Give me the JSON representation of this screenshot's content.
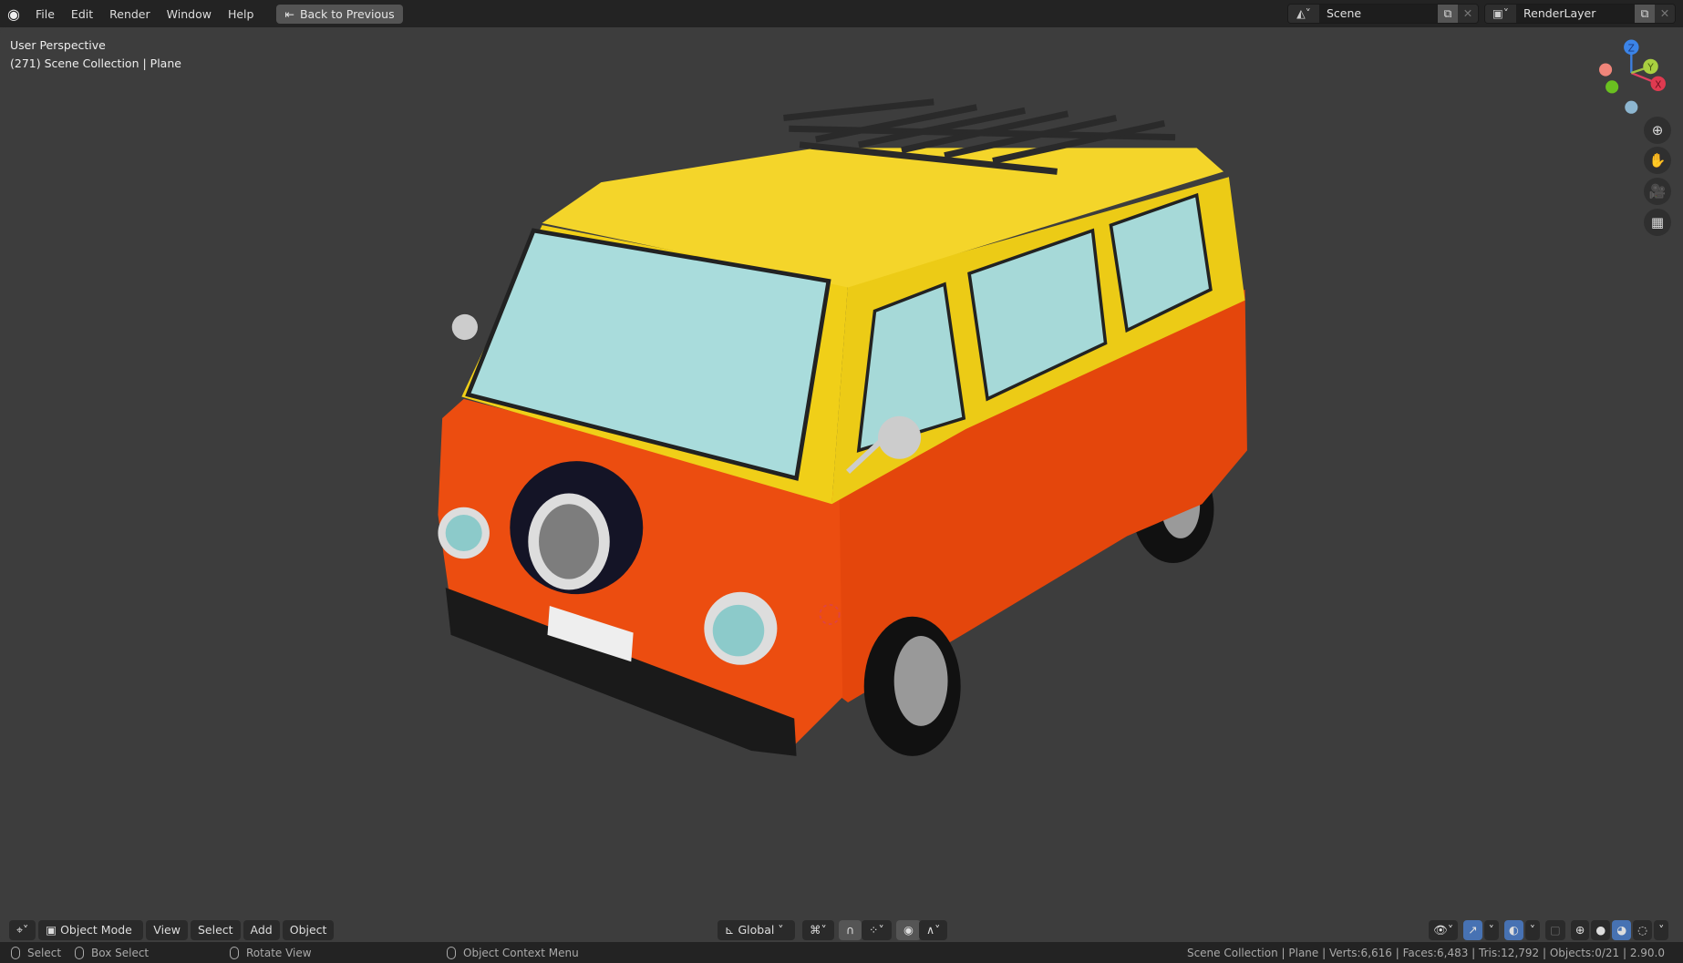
{
  "topbar": {
    "menus": [
      "File",
      "Edit",
      "Render",
      "Window",
      "Help"
    ],
    "back_button": "Back to Previous",
    "scene": "Scene",
    "render_layer": "RenderLayer"
  },
  "viewport": {
    "perspective": "User Perspective",
    "collection": "(271) Scene Collection | Plane",
    "gizmo": {
      "z": "Z",
      "y": "Y",
      "x": "X"
    }
  },
  "header": {
    "mode": "Object Mode",
    "menus": [
      "View",
      "Select",
      "Add",
      "Object"
    ],
    "orientation": "Global"
  },
  "status": {
    "select": "Select",
    "box_select": "Box Select",
    "rotate": "Rotate View",
    "context": "Object Context Menu",
    "stats": "Scene Collection | Plane | Verts:6,616 | Faces:6,483 | Tris:12,792 | Objects:0/21 | 2.90.0"
  },
  "colors": {
    "yellow": "#f2d21a",
    "orange": "#e8480e",
    "glass": "#a8dcdc",
    "accent": "#4772b3"
  }
}
